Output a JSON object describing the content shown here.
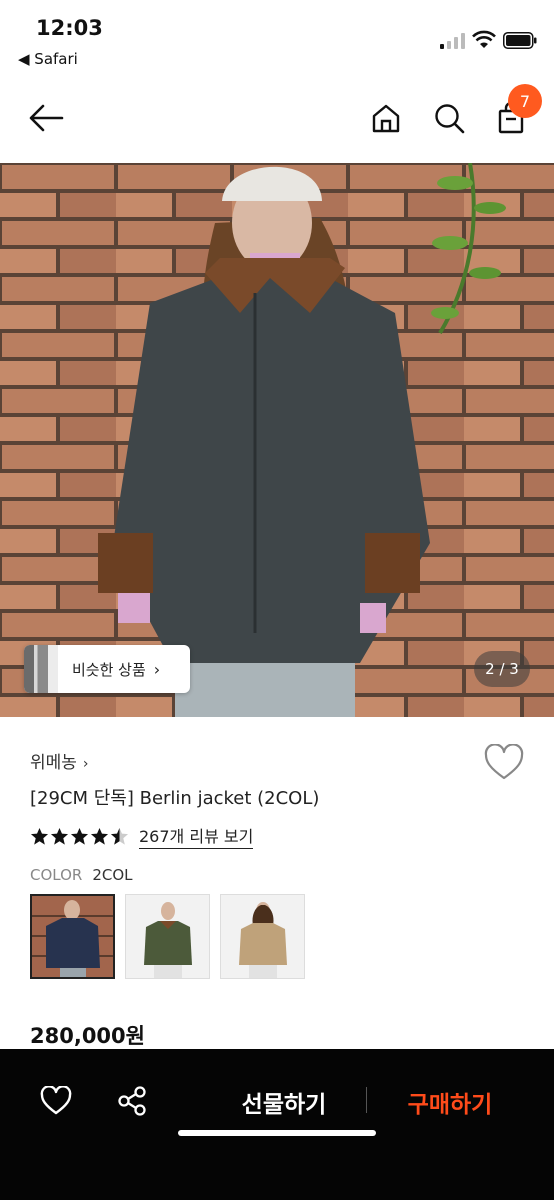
{
  "status_bar": {
    "time": "12:03",
    "back_app": "◀ Safari",
    "icons": [
      "signal-icon",
      "wifi-icon",
      "battery-icon"
    ]
  },
  "nav": {
    "cart_count": "7",
    "icons": [
      "back-arrow-icon",
      "home-icon",
      "search-icon",
      "shopping-bag-icon"
    ]
  },
  "hero": {
    "similar_button_label": "비슷한 상품",
    "similar_chevron": "›",
    "image_counter": "2 / 3"
  },
  "product": {
    "brand": "위메농",
    "brand_chevron": "›",
    "title": "[29CM 단독] Berlin jacket (2COL)",
    "rating_value": 4.5,
    "review_link": "267개 리뷰 보기",
    "color_label": "COLOR",
    "color_value": "2COL",
    "price": "280,000원"
  },
  "bottom_bar": {
    "gift_label": "선물하기",
    "buy_label": "구매하기",
    "icons": [
      "heart-icon",
      "share-icon"
    ]
  },
  "colors": {
    "accent": "#ff5a1f",
    "buy_text": "#ff4b1a",
    "bottom_bar_bg": "#050505"
  }
}
